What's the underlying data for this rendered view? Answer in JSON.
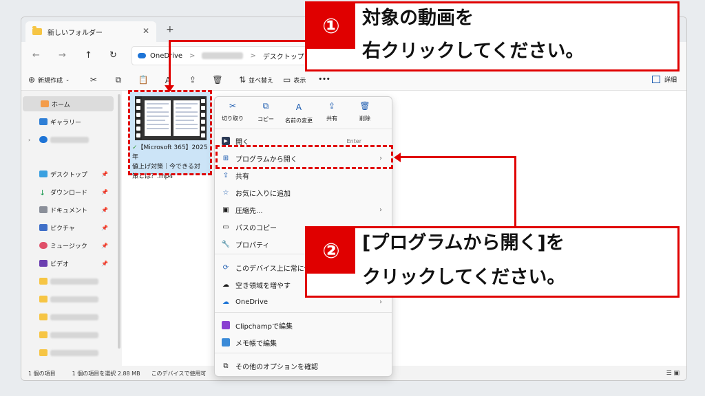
{
  "window": {
    "tab_title": "新しいフォルダー",
    "tab_close": "✕",
    "tab_add": "+"
  },
  "nav": {
    "back": "←",
    "forward": "→",
    "up": "↑",
    "refresh": "↻"
  },
  "address": {
    "segment1": "OneDrive",
    "segment3": "デスクトップ",
    "separator": ">"
  },
  "toolbar": {
    "new_label": "新規作成",
    "sort_label": "並べ替え",
    "view_label": "表示",
    "more_label": "•••",
    "details_label": "詳細"
  },
  "sidebar": {
    "home": "ホーム",
    "gallery": "ギャラリー",
    "desktop": "デスクトップ",
    "downloads": "ダウンロード",
    "documents": "ドキュメント",
    "pictures": "ピクチャ",
    "music": "ミュージック",
    "videos": "ビデオ"
  },
  "file": {
    "name_line1": "【Microsoft 365】2025年",
    "name_line2": "値上げ対策｜今できる対",
    "name_line3": "策とは？.mp4"
  },
  "status": {
    "count": "1 個の項目",
    "selected": "1 個の項目を選択  2.88 MB",
    "availability": "このデバイスで使用可"
  },
  "context_menu": {
    "quick": [
      "切り取り",
      "コピー",
      "名前の変更",
      "共有",
      "削除"
    ],
    "open": "開く",
    "open_shortcut": "Enter",
    "open_with": "プログラムから開く",
    "share": "共有",
    "favorite": "お気に入りに追加",
    "compress": "圧縮先...",
    "copy_path": "パスのコピー",
    "properties": "プロパティ",
    "keep_on_device": "このデバイス上に常に保",
    "free_space": "空き領域を増やす",
    "onedrive": "OneDrive",
    "clipchamp": "Clipchampで編集",
    "notepad": "メモ帳で編集",
    "more_options": "その他のオプションを確認"
  },
  "callout1": {
    "num": "①",
    "line1": "対象の動画を",
    "line2": "右クリックしてください。"
  },
  "callout2": {
    "num": "②",
    "line1": "[プログラムから開く]を",
    "line2": "クリックしてください。"
  },
  "colors": {
    "accent": "#e00000",
    "selection": "#cce4f7"
  }
}
